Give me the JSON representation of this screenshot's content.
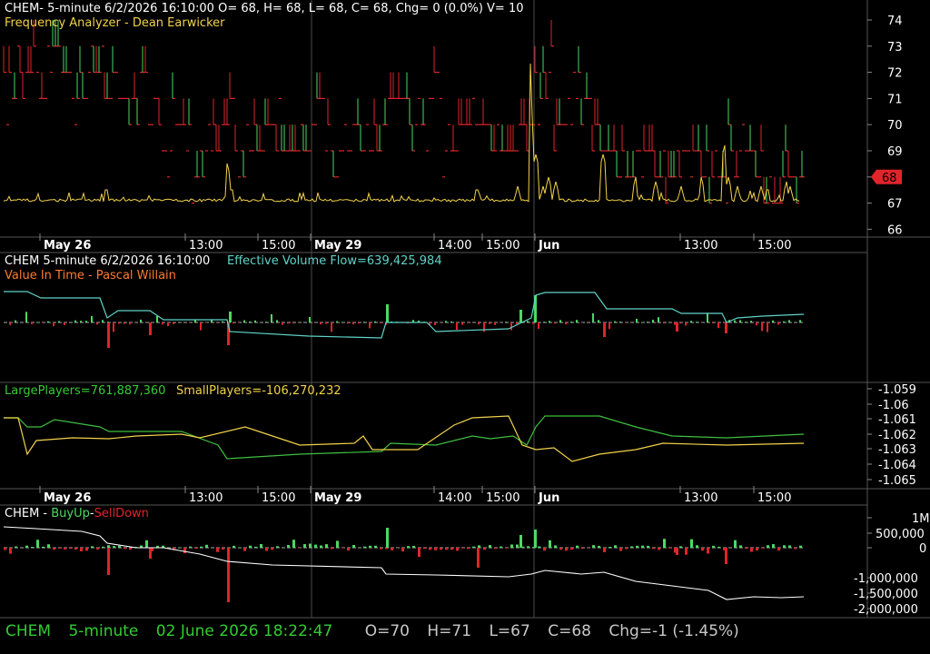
{
  "colors": {
    "background": "#000000",
    "grid": "#3a3a3a",
    "up": "#4cd964",
    "down": "#e0242b",
    "yellow": "#f2d24a",
    "cyan": "#5fd3c8",
    "white": "#ffffff",
    "greenText": "#33cc33",
    "orangeText": "#ff7a2e"
  },
  "panel1": {
    "header": "CHEM- 5-minute 6/2/2026 16:10:00 O= 68, H= 68, L= 68, C= 68, Chg= 0 (0.0%) V= 10",
    "subtitle": "Frequency Analyzer - Dean Earwicker",
    "last_price_tag": "68",
    "y_ticks": [
      "74",
      "73",
      "72",
      "71",
      "70",
      "69",
      "68",
      "67",
      "66"
    ]
  },
  "x_axis": {
    "labels": [
      {
        "text": "May 26",
        "bold": true
      },
      {
        "text": "13:00",
        "bold": false
      },
      {
        "text": "15:00",
        "bold": false
      },
      {
        "text": "May 29",
        "bold": true
      },
      {
        "text": "14:00",
        "bold": false
      },
      {
        "text": "15:00",
        "bold": false
      },
      {
        "text": "Jun",
        "bold": true
      },
      {
        "text": "13:00",
        "bold": false
      },
      {
        "text": "15:00",
        "bold": false
      }
    ]
  },
  "panel2": {
    "header_left": "CHEM 5-minute  6/2/2026 16:10:00",
    "header_right": "Effective Volume Flow=639,425,984",
    "subtitle": "Value In Time - Pascal Willain"
  },
  "panel3": {
    "large_players": "LargePlayers=761,887,360",
    "small_players": "SmallPlayers=-106,270,232",
    "y_ticks": [
      "-1.059",
      "-1.06",
      "-1.061",
      "-1.062",
      "-1.063",
      "-1.064",
      "-1.065"
    ]
  },
  "panel4": {
    "label_symbol": "CHEM",
    "label_dash1": " - ",
    "label_buyup": "BuyUp",
    "label_dash2": "-",
    "label_selldown": "SellDown",
    "y_ticks": [
      "1M",
      "500,000",
      "0",
      "-1,000,000",
      "-1,500,000",
      "-2,000,000"
    ]
  },
  "status_bar": {
    "symbol": "CHEM",
    "interval": "5-minute",
    "datetime": "02 June 2026 18:22:47",
    "open": "O=70",
    "high": "H=71",
    "low": "L=67",
    "close": "C=68",
    "change": "Chg=-1 (-1.45%)"
  }
}
